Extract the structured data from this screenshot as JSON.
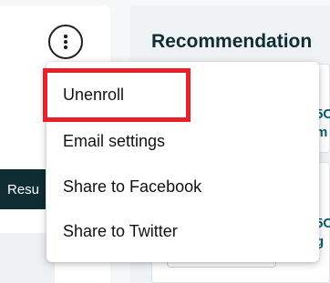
{
  "left_card": {
    "more_options_icon": "vertical-ellipsis",
    "resume_button_label": "Resu"
  },
  "recommendations": {
    "title": "Recommendation",
    "card1_snippet": [
      "5C",
      "m"
    ],
    "card2_snippet": [
      "5C",
      "g"
    ]
  },
  "menu": {
    "items": [
      {
        "label": "Unenroll"
      },
      {
        "label": "Email settings"
      },
      {
        "label": "Share to Facebook"
      },
      {
        "label": "Share to Twitter"
      }
    ]
  },
  "highlight": {
    "color": "#e8202a",
    "target": "Unenroll"
  },
  "colors": {
    "dark_teal": "#0f2d33",
    "link_teal": "#0a5d70"
  }
}
